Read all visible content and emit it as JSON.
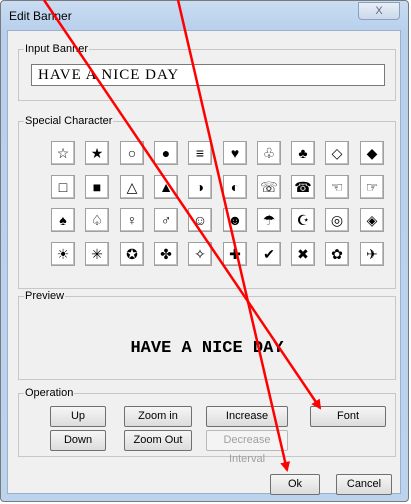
{
  "window": {
    "title": "Edit Banner",
    "close_label": "X"
  },
  "input_banner": {
    "label": "Input Banner",
    "value": "HAVE A NICE DAY"
  },
  "special": {
    "label": "Special Character",
    "rows": [
      [
        "☆",
        "★",
        "○",
        "●",
        "≡",
        "♥",
        "♧",
        "♣",
        "◇",
        "◆"
      ],
      [
        "□",
        "■",
        "△",
        "▲",
        "◑",
        "◐",
        "☏",
        "☎",
        "☜",
        "☞"
      ],
      [
        "♠",
        "♤",
        "♀",
        "♂",
        "☺",
        "☻",
        "☂",
        "☪",
        "◎",
        "◈"
      ],
      [
        "☀",
        "✳",
        "✪",
        "✤",
        "✧",
        "✚",
        "✔",
        "✖",
        "✿",
        "✈"
      ]
    ]
  },
  "preview": {
    "label": "Preview",
    "text": "HAVE A NICE DAY"
  },
  "operation": {
    "label": "Operation",
    "up": "Up",
    "down": "Down",
    "zoom_in": "Zoom in",
    "zoom_out": "Zoom Out",
    "increase_interval": "Increase Interval",
    "decrease_interval": "Decrease Interval",
    "font": "Font"
  },
  "footer": {
    "ok": "Ok",
    "cancel": "Cancel"
  },
  "colors": {
    "annotation_arrow": "#ff0000"
  }
}
